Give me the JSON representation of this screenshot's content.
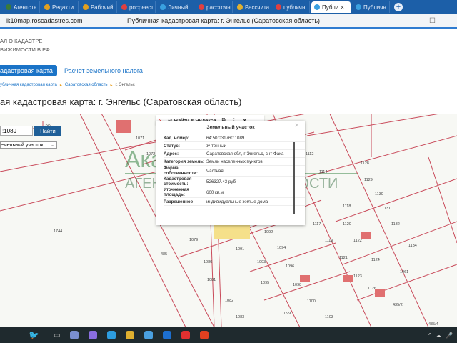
{
  "browser": {
    "tabs": [
      {
        "label": "Агентств",
        "color": "#3a7a3a"
      },
      {
        "label": "Редакти",
        "color": "#e0a020"
      },
      {
        "label": "Рабочий",
        "color": "#e0a020"
      },
      {
        "label": "росреест",
        "color": "#e04040"
      },
      {
        "label": "Личный",
        "color": "#3aa0e0"
      },
      {
        "label": "расстоян",
        "color": "#e04040"
      },
      {
        "label": "Рассчита",
        "color": "#e0b030"
      },
      {
        "label": "публичн",
        "color": "#e04040"
      },
      {
        "label": "Публи",
        "color": "#3aa0e0",
        "active": true
      },
      {
        "label": "Публичн",
        "color": "#3aa0e0"
      }
    ],
    "url": "lk10map.roscadastres.com",
    "page_title": "Публичная кадастровая карта: г. Энгельс (Саратовская область)"
  },
  "header": {
    "line1": "АЛ О КАДАСТРЕ",
    "line2": "ВИЖИМОСТИ В РФ"
  },
  "nav": {
    "active": "адастровая карта",
    "link": "Расчет земельного налога"
  },
  "breadcrumb": [
    "убличная кадастровая карта",
    "Саратовская область",
    "г. Энгельс"
  ],
  "heading": "ая кадастровая карта: г. Энгельс (Саратовская область)",
  "search": {
    "value": ":1089",
    "button": "Найти",
    "type_select": "емельный участок"
  },
  "toolbar": {
    "find_yandex": "Найти в Яндексе"
  },
  "popup": {
    "title": "Земельный участок",
    "rows": [
      {
        "k": "Кад. номер:",
        "v": "64:50:031760:1089"
      },
      {
        "k": "Статус:",
        "v": "Учтенный"
      },
      {
        "k": "Адрес:",
        "v": "Саратовская обл, г Энгельс, снт Фака"
      },
      {
        "k": "Категория земель:",
        "v": "Земли населенных пунктов"
      },
      {
        "k": "Форма собственности:",
        "v": "Частная"
      },
      {
        "k": "Кадастровая стоимость:",
        "v": "526327.43 руб"
      },
      {
        "k": "Уточненная площадь:",
        "v": "600 кв.м"
      },
      {
        "k": "Разрешенное",
        "v": "индивидуальные жилые дома"
      }
    ]
  },
  "watermark": {
    "line1": "Академия жилья",
    "line2": "АГЕНТСТВО НЕДВИЖИМОСТИ"
  },
  "parcels": [
    "1071",
    "1072",
    "1744",
    "485",
    "1079",
    "1080",
    "1081",
    "1082",
    "1083",
    "1091",
    "1092",
    "1093",
    "1094",
    "1095",
    "1096",
    "1098",
    "1099",
    "1100",
    "1103",
    "1112",
    "1114",
    "1117",
    "1118",
    "1119",
    "1120",
    "1121",
    "1122",
    "1123",
    "1124",
    "1126",
    "1128",
    "1129",
    "1130",
    "1131",
    "1132",
    "1134",
    "1061",
    "435/2",
    "435/4",
    "1249"
  ],
  "taskbar": {
    "apps": [
      "#7a8fd0",
      "#8a6ee0",
      "#2d9de0",
      "#e0b030",
      "#4aa0e0",
      "#1d6fd0",
      "#e03030",
      "#e04020"
    ]
  }
}
